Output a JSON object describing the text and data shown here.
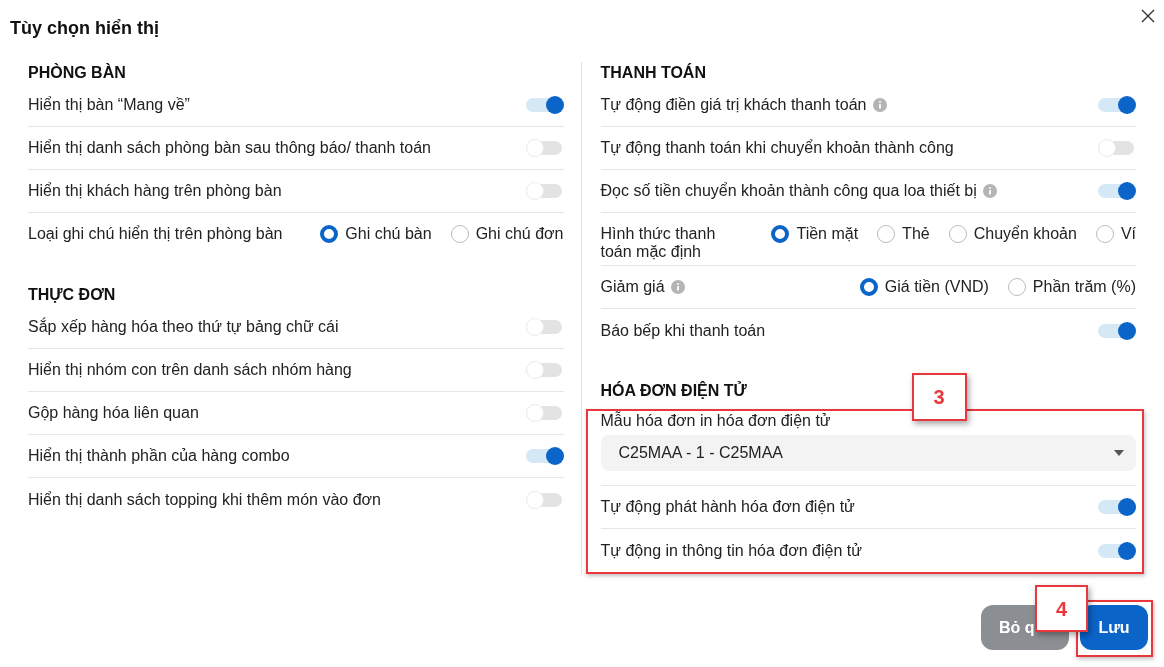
{
  "dialog": {
    "title": "Tùy chọn hiển thị"
  },
  "columns": [
    {
      "sections": [
        {
          "title": "PHÒNG BÀN",
          "items": [
            {
              "kind": "toggle",
              "label": "Hiển thị bàn “Mang về”",
              "info_icon": false,
              "on": true
            },
            {
              "kind": "toggle",
              "label": "Hiển thị danh sách phòng bàn sau thông báo/ thanh toán",
              "info_icon": false,
              "on": false
            },
            {
              "kind": "toggle",
              "label": "Hiển thị khách hàng trên phòng bàn",
              "info_icon": false,
              "on": false
            },
            {
              "kind": "radio",
              "label": "Loại ghi chú hiển thị trên phòng bàn",
              "info_icon": false,
              "options": [
                {
                  "label": "Ghi chú bàn",
                  "selected": true
                },
                {
                  "label": "Ghi chú đơn",
                  "selected": false
                }
              ]
            }
          ]
        },
        {
          "title": "THỰC ĐƠN",
          "items": [
            {
              "kind": "toggle",
              "label": "Sắp xếp hàng hóa theo thứ tự bảng chữ cái",
              "info_icon": false,
              "on": false
            },
            {
              "kind": "toggle",
              "label": "Hiển thị nhóm con trên danh sách nhóm hàng",
              "info_icon": false,
              "on": false
            },
            {
              "kind": "toggle",
              "label": "Gộp hàng hóa liên quan",
              "info_icon": false,
              "on": false
            },
            {
              "kind": "toggle",
              "label": "Hiển thị thành phần của hàng combo",
              "info_icon": false,
              "on": true
            },
            {
              "kind": "toggle",
              "label": "Hiển thị danh sách topping khi thêm món vào đơn",
              "info_icon": false,
              "on": false
            }
          ]
        }
      ]
    },
    {
      "sections": [
        {
          "title": "THANH TOÁN",
          "items": [
            {
              "kind": "toggle",
              "label": "Tự động điền giá trị khách thanh toán",
              "info_icon": true,
              "on": true
            },
            {
              "kind": "toggle",
              "label": "Tự động thanh toán khi chuyển khoản thành công",
              "info_icon": false,
              "on": false
            },
            {
              "kind": "toggle",
              "label": "Đọc số tiền chuyển khoản thành công qua loa thiết bị",
              "info_icon": true,
              "on": true
            },
            {
              "kind": "radio",
              "label": "Hình thức thanh toán mặc định",
              "info_icon": false,
              "options": [
                {
                  "label": "Tiền mặt",
                  "selected": true
                },
                {
                  "label": "Thẻ",
                  "selected": false
                },
                {
                  "label": "Chuyển khoản",
                  "selected": false
                },
                {
                  "label": "Ví",
                  "selected": false
                }
              ]
            },
            {
              "kind": "radio",
              "label": "Giảm giá",
              "info_icon": true,
              "options": [
                {
                  "label": "Giá tiền (VND)",
                  "selected": true
                },
                {
                  "label": "Phần trăm (%)",
                  "selected": false
                }
              ]
            },
            {
              "kind": "toggle",
              "label": "Báo bếp khi thanh toán",
              "info_icon": false,
              "on": true
            }
          ]
        },
        {
          "title": "HÓA ĐƠN ĐIỆN TỬ",
          "callout": "3",
          "items": [
            {
              "kind": "select",
              "label": "Mẫu hóa đơn in hóa đơn điện tử",
              "value": "C25MAA - 1 - C25MAA"
            },
            {
              "kind": "toggle",
              "label": "Tự động phát hành hóa đơn điện tử",
              "info_icon": false,
              "on": true
            },
            {
              "kind": "toggle",
              "label": "Tự động in thông tin hóa đơn điện tử",
              "info_icon": false,
              "on": true
            }
          ]
        }
      ]
    }
  ],
  "buttons": [
    {
      "kind": "secondary",
      "label": "Bỏ q"
    },
    {
      "kind": "primary",
      "label": "Lưu",
      "callout": "4"
    }
  ]
}
